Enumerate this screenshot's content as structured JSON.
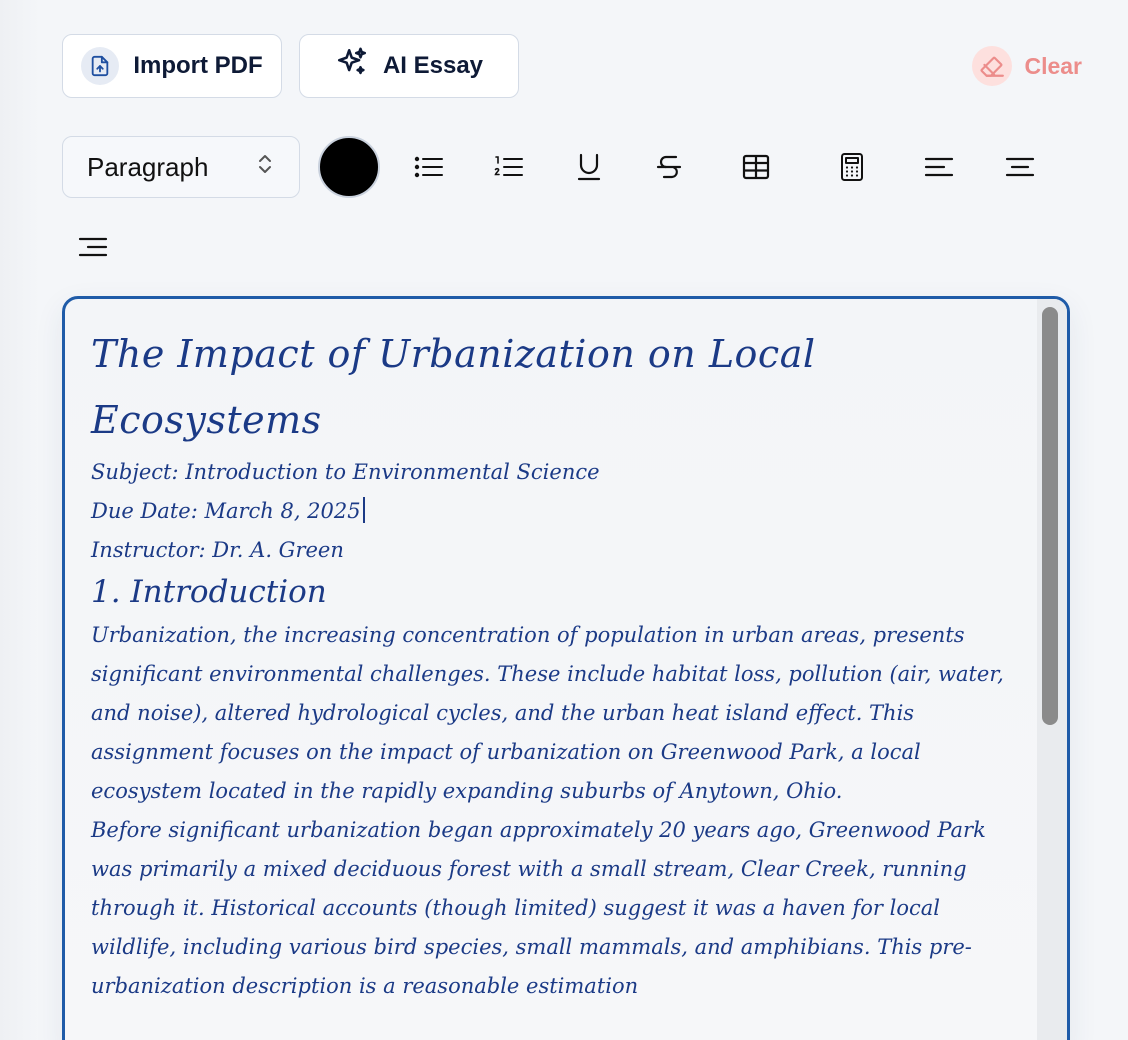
{
  "toolbar_top": {
    "import_label": "Import PDF",
    "ai_label": "AI Essay",
    "clear_label": "Clear"
  },
  "format_toolbar": {
    "block_style": "Paragraph",
    "text_color": "#000000",
    "tools": [
      "bullet-list-icon",
      "numbered-list-icon",
      "underline-icon",
      "strikethrough-icon",
      "table-icon",
      "calculator-icon",
      "align-left-icon",
      "align-center-icon",
      "align-right-icon"
    ]
  },
  "colors": {
    "accent": "#1f5ba8",
    "ink": "#1b3a86",
    "clear": "#ec8d8b"
  },
  "document": {
    "title": "The Impact of Urbanization on Local Ecosystems",
    "subject": "Subject: Introduction to Environmental Science",
    "due_date": "Due Date: March 8, 2025",
    "instructor": "Instructor: Dr. A. Green",
    "heading_1": "1. Introduction",
    "paragraph_1": "Urbanization, the increasing concentration of population in urban areas, presents significant environmental challenges. These include habitat loss, pollution (air, water, and noise), altered hydrological cycles, and the urban heat island effect. This assignment focuses on the impact of urbanization on Greenwood Park, a local ecosystem located in the rapidly expanding suburbs of Anytown, Ohio.",
    "paragraph_2": "Before significant urbanization began approximately 20 years ago, Greenwood Park was primarily a mixed deciduous forest with a small stream, Clear Creek, running through it. Historical accounts (though limited) suggest it was a haven for local wildlife, including various bird species, small mammals, and amphibians. This pre-urbanization description is a reasonable estimation"
  }
}
